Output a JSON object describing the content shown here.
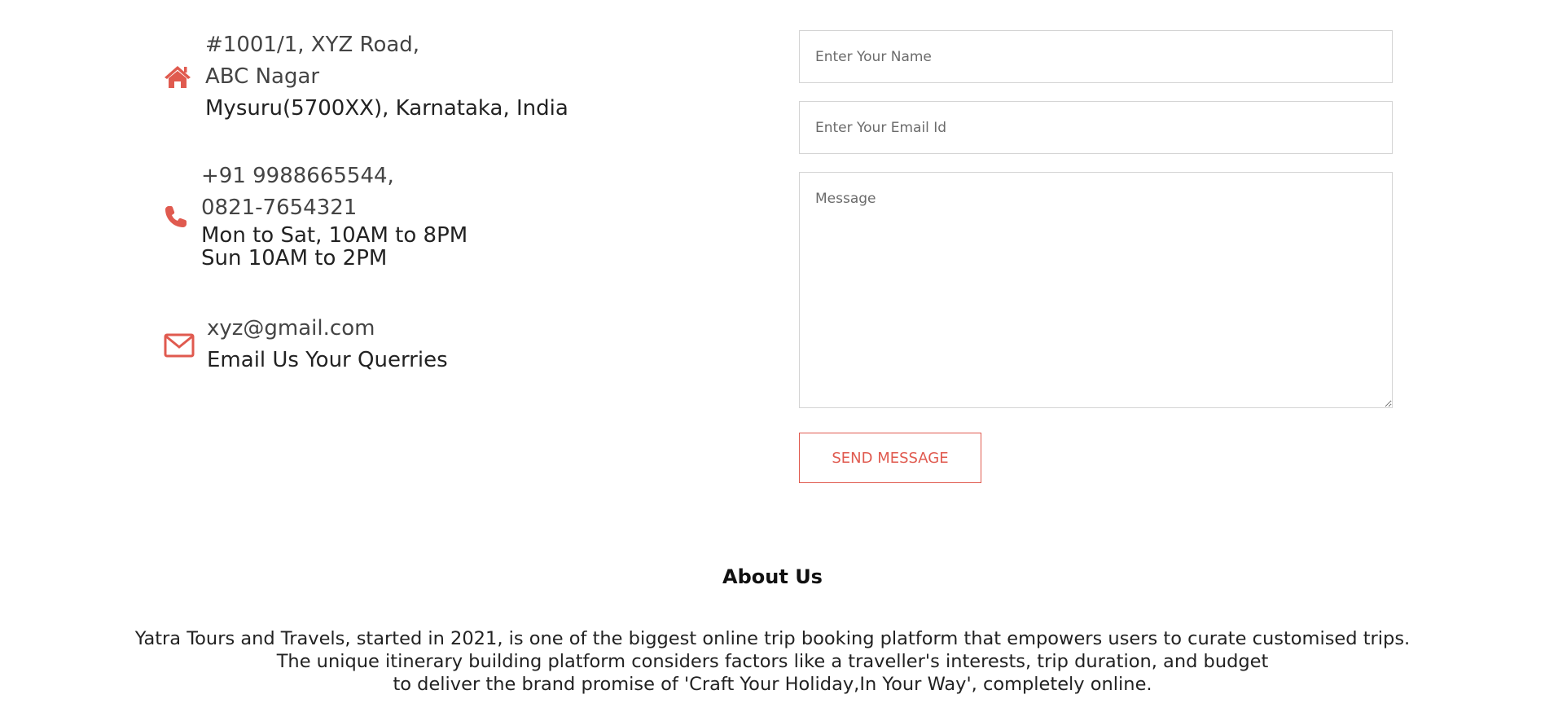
{
  "contact": {
    "address": {
      "icon": "home-icon",
      "line1": "#1001/1, XYZ Road,",
      "line2": "ABC Nagar",
      "line3": "Mysuru(5700XX), Karnataka, India"
    },
    "phone": {
      "icon": "phone-icon",
      "line1": "+91 9988665544,",
      "line2": "0821-7654321",
      "hours1": "Mon to Sat, 10AM to 8PM",
      "hours2": "Sun 10AM to 2PM"
    },
    "email": {
      "icon": "envelope-icon",
      "address": "xyz@gmail.com",
      "caption": "Email Us Your Querries"
    },
    "icon_color": "#e05a4f"
  },
  "form": {
    "name_placeholder": "Enter Your Name",
    "email_placeholder": "Enter Your Email Id",
    "message_placeholder": "Message",
    "submit_label": "SEND MESSAGE",
    "accent_color": "#e05a4f"
  },
  "about": {
    "title": "About Us",
    "line1": "Yatra Tours and Travels, started in 2021, is one of the biggest online trip booking platform that empowers users to curate customised trips.",
    "line2": "The unique itinerary building platform considers factors like a traveller's interests, trip duration, and budget",
    "line3": "to deliver the brand promise of 'Craft Your Holiday,In Your Way', completely online."
  }
}
